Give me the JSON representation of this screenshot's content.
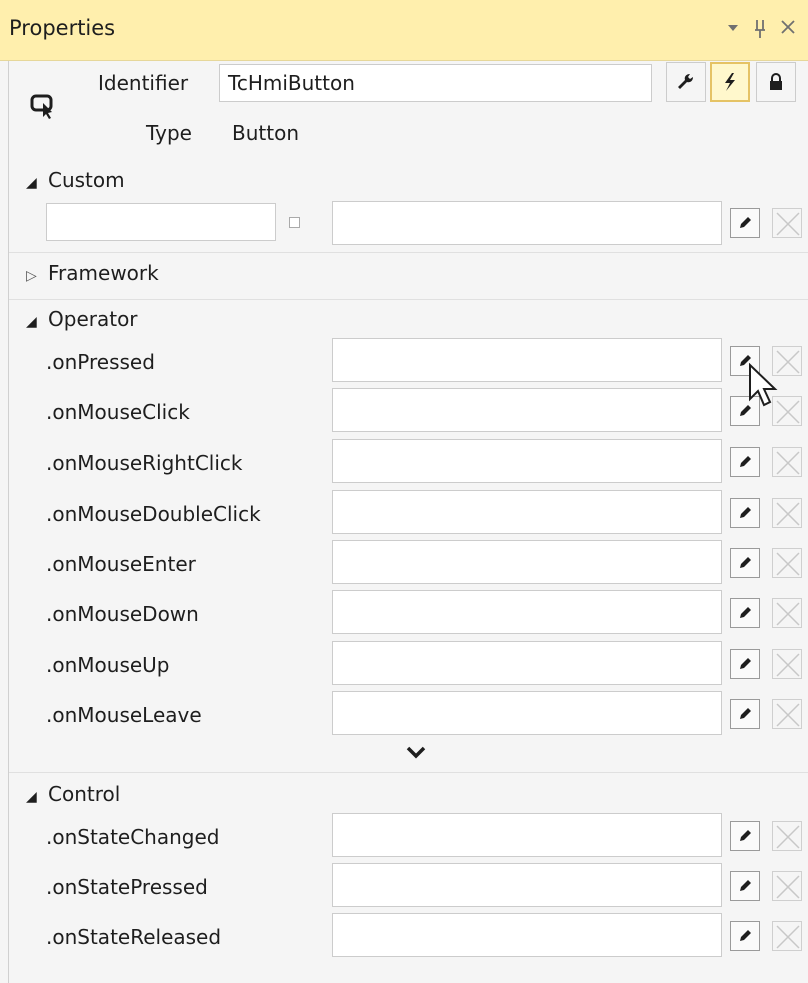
{
  "window": {
    "title": "Properties",
    "controls": [
      {
        "icon": "dropdown-arrow-icon",
        "glyph": "▾"
      },
      {
        "icon": "pin-icon",
        "glyph": "⊥"
      },
      {
        "icon": "close-icon",
        "glyph": "✕"
      }
    ]
  },
  "header": {
    "identifier_label": "Identifier",
    "identifier_value": "TcHmiButton",
    "type_label": "Type",
    "type_value": "Button",
    "toolbar": [
      {
        "icon": "wrench-icon",
        "active": false
      },
      {
        "icon": "lightning-icon",
        "active": true
      },
      {
        "icon": "lock-icon",
        "active": false
      }
    ]
  },
  "sections": {
    "custom": {
      "label": "Custom",
      "expanded": true
    },
    "framework": {
      "label": "Framework",
      "expanded": false
    },
    "operator": {
      "label": "Operator",
      "expanded": true,
      "events": [
        ".onPressed",
        ".onMouseClick",
        ".onMouseRightClick",
        ".onMouseDoubleClick",
        ".onMouseEnter",
        ".onMouseDown",
        ".onMouseUp",
        ".onMouseLeave"
      ]
    },
    "control": {
      "label": "Control",
      "expanded": true,
      "events": [
        ".onStateChanged",
        ".onStatePressed",
        ".onStateReleased"
      ]
    }
  },
  "colors": {
    "titlebar_bg": "#ffefad",
    "panel_bg": "#f5f5f5",
    "active_tool_bg": "#fff8cc",
    "active_tool_border": "#e5c365"
  }
}
